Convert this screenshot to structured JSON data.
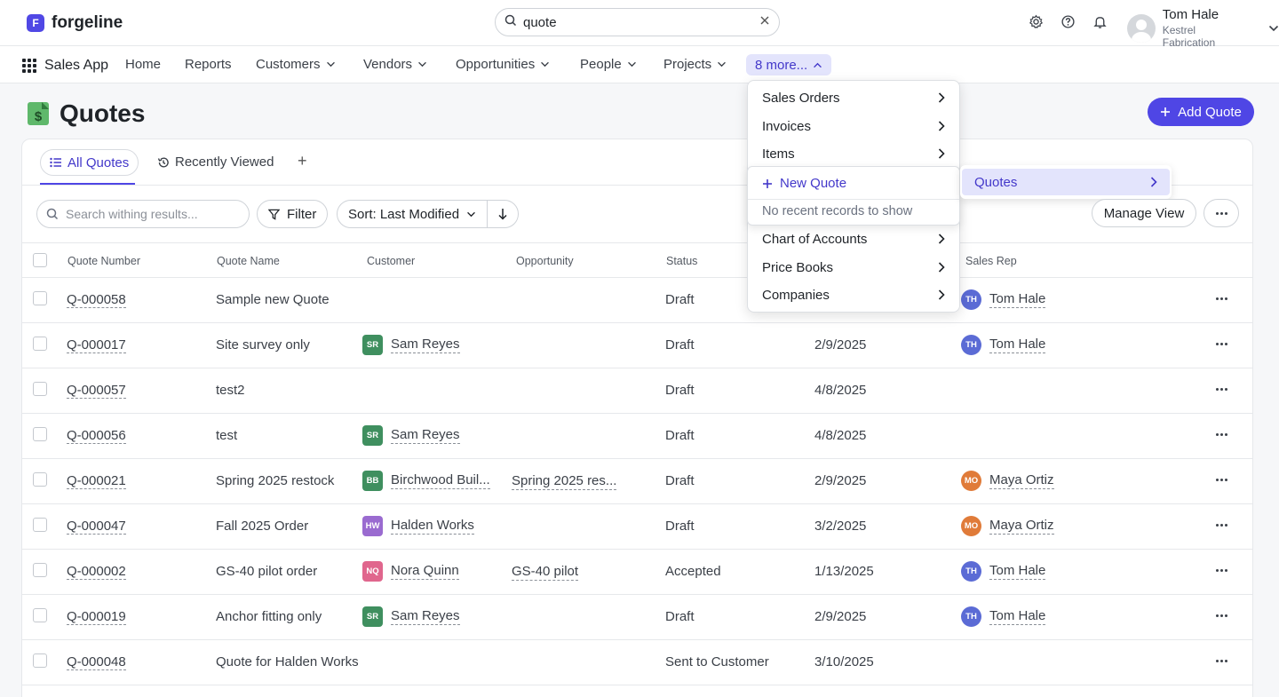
{
  "brand": {
    "name": "forgeline",
    "mark": "F"
  },
  "global_search": {
    "value": "quote"
  },
  "user": {
    "name": "Tom Hale",
    "org": "Kestrel Fabrication"
  },
  "nav": {
    "app_name": "Sales App",
    "items": [
      "Home",
      "Reports",
      "Customers",
      "Vendors",
      "Opportunities",
      "People",
      "Projects"
    ],
    "more_label": "8 more..."
  },
  "page": {
    "title": "Quotes",
    "icon_glyph": "$",
    "add_label": "Add Quote"
  },
  "tabs": {
    "all": "All Quotes",
    "recent": "Recently Viewed",
    "add": "+"
  },
  "toolbar": {
    "search_placeholder": "Search withing results...",
    "filter_label": "Filter",
    "sort_label": "Sort: Last Modified",
    "manage_label": "Manage View"
  },
  "columns": [
    "Quote Number",
    "Quote Name",
    "Customer",
    "Opportunity",
    "Status",
    "Sales Rep"
  ],
  "rows": [
    {
      "number": "Q-000058",
      "name": "Sample new Quote",
      "customer": null,
      "opportunity": "",
      "status": "Draft",
      "date": "",
      "rep": {
        "initials": "TH",
        "name": "Tom Hale",
        "color": "#5b6bd5"
      }
    },
    {
      "number": "Q-000017",
      "name": "Site survey only",
      "customer": {
        "initials": "SR",
        "name": "Sam Reyes",
        "color": "#3f8f5f"
      },
      "opportunity": "",
      "status": "Draft",
      "date": "2/9/2025",
      "rep": {
        "initials": "TH",
        "name": "Tom Hale",
        "color": "#5b6bd5"
      }
    },
    {
      "number": "Q-000057",
      "name": "test2",
      "customer": null,
      "opportunity": "",
      "status": "Draft",
      "date": "4/8/2025",
      "rep": null
    },
    {
      "number": "Q-000056",
      "name": "test",
      "customer": {
        "initials": "SR",
        "name": "Sam Reyes",
        "color": "#3f8f5f"
      },
      "opportunity": "",
      "status": "Draft",
      "date": "4/8/2025",
      "rep": null
    },
    {
      "number": "Q-000021",
      "name": "Spring 2025 restock",
      "customer": {
        "initials": "BB",
        "name": "Birchwood Buil...",
        "color": "#3f8f5f"
      },
      "opportunity": "Spring 2025 res...",
      "status": "Draft",
      "date": "2/9/2025",
      "rep": {
        "initials": "MO",
        "name": "Maya Ortiz",
        "color": "#e07b39"
      }
    },
    {
      "number": "Q-000047",
      "name": "Fall 2025 Order",
      "customer": {
        "initials": "HW",
        "name": "Halden Works",
        "color": "#9a6bd0"
      },
      "opportunity": "",
      "status": "Draft",
      "date": "3/2/2025",
      "rep": {
        "initials": "MO",
        "name": "Maya Ortiz",
        "color": "#e07b39"
      }
    },
    {
      "number": "Q-000002",
      "name": "GS-40 pilot order",
      "customer": {
        "initials": "NQ",
        "name": "Nora Quinn",
        "color": "#e0668d"
      },
      "opportunity": "GS-40 pilot",
      "status": "Accepted",
      "date": "1/13/2025",
      "rep": {
        "initials": "TH",
        "name": "Tom Hale",
        "color": "#5b6bd5"
      }
    },
    {
      "number": "Q-000019",
      "name": "Anchor fitting only",
      "customer": {
        "initials": "SR",
        "name": "Sam Reyes",
        "color": "#3f8f5f"
      },
      "opportunity": "",
      "status": "Draft",
      "date": "2/9/2025",
      "rep": {
        "initials": "TH",
        "name": "Tom Hale",
        "color": "#5b6bd5"
      }
    },
    {
      "number": "Q-000048",
      "name": "Quote for Halden Works",
      "customer": null,
      "opportunity": "",
      "status": "Sent to Customer",
      "date": "3/10/2025",
      "rep": null
    }
  ],
  "more_menu": {
    "items": [
      "Sales Orders",
      "Invoices",
      "Items",
      "Quotes",
      "Chart of Accounts",
      "Price Books",
      "Companies"
    ],
    "quotes_submenu": {
      "new_label": "New Quote",
      "empty_text": "No recent records to show"
    }
  }
}
